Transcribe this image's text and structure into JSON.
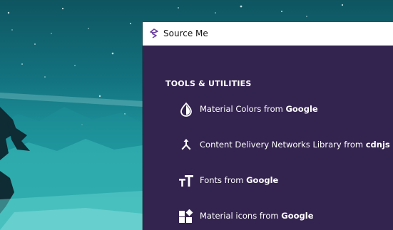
{
  "window": {
    "title": "Source Me",
    "icon": "source-me-logo-icon",
    "accent_color": "#33234f"
  },
  "tools": {
    "section_title": "TOOLS & UTILITIES",
    "items": [
      {
        "icon": "color-drop-icon",
        "label": "Material Colors from ",
        "source": "Google"
      },
      {
        "icon": "merge-arrows-icon",
        "label": "Content Delivery Networks Library from ",
        "source": "cdnjs"
      },
      {
        "icon": "font-size-icon",
        "label": "Fonts from ",
        "source": "Google"
      },
      {
        "icon": "widgets-icon",
        "label": "Material icons from ",
        "source": "Google"
      }
    ]
  }
}
